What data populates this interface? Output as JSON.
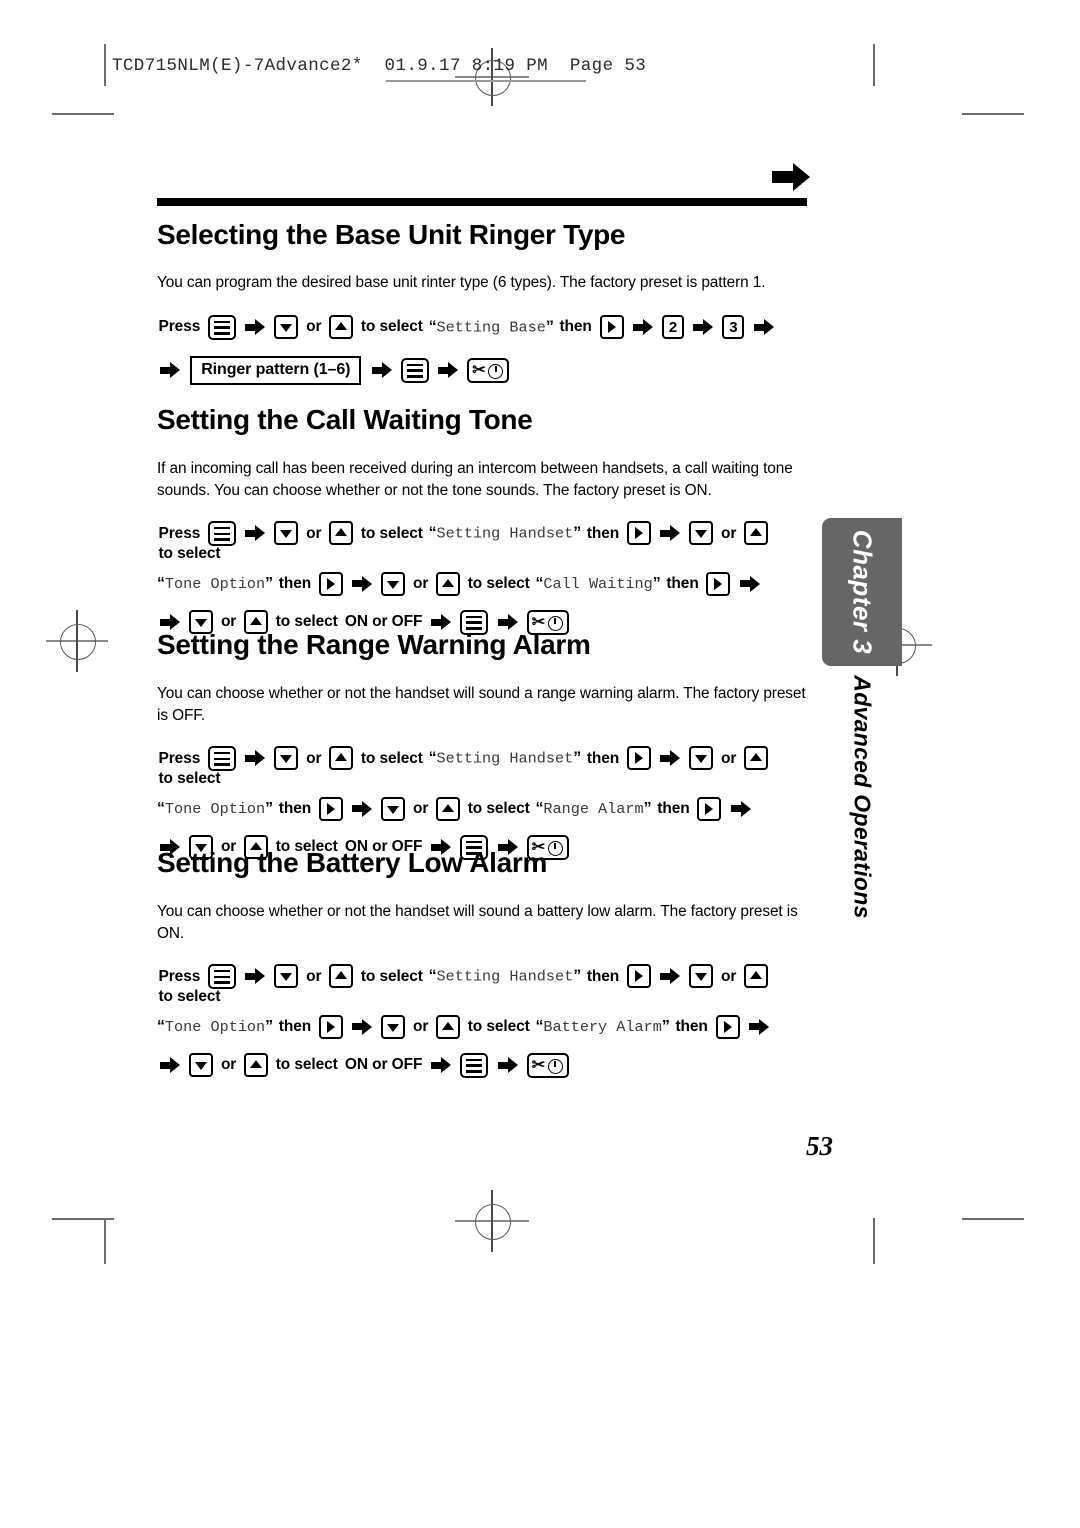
{
  "print_slug": {
    "text": "TCD715NLM(E)-7Advance2*  01.9.17 8:19 PM  Page 53"
  },
  "page_number": "53",
  "chapter_tab": {
    "title": "Chapter 3",
    "subtitle": "Advanced Operations",
    "background_color": "#666666",
    "title_color": "#ffffff"
  },
  "icons": {
    "menu": "menu-key-icon",
    "down": "down-arrow-key-icon",
    "up": "up-arrow-key-icon",
    "right": "right-arrow-key-icon",
    "off": "phone-off-key-icon",
    "step_arrow": "step-arrow-icon",
    "section_arrow": "section-pointer-arrow-icon"
  },
  "sections": [
    {
      "id": "base-unit-ringer-type",
      "heading": "Selecting the Base Unit Ringer Type",
      "body": "You can program the desired base unit rinter type (6 types). The factory preset is pattern 1.",
      "steps_line1": {
        "press_label": "Press",
        "or_label": "or",
        "to_select_label": "to select",
        "then_label": "then",
        "target": "Setting Base",
        "num_keys": [
          "2",
          "3"
        ]
      },
      "steps_line2": {
        "boxed_label": "Ringer pattern (1–6)"
      }
    },
    {
      "id": "call-waiting-tone",
      "heading": "Setting the Call Waiting Tone",
      "body": "If an incoming call has been received during an intercom between handsets, a call waiting tone sounds. You can choose whether or not the tone sounds. The factory preset is ON.",
      "steps": {
        "press_label": "Press",
        "or_label": "or",
        "to_select_label": "to select",
        "then_label": "then",
        "target1": "Setting Handset",
        "target2": "Tone Option",
        "target3": "Call Waiting",
        "on_off_label": "ON or OFF"
      }
    },
    {
      "id": "range-warning-alarm",
      "heading": "Setting the Range Warning Alarm",
      "body": "You can choose whether or not the handset will sound a range warning alarm. The factory preset is OFF.",
      "steps": {
        "press_label": "Press",
        "or_label": "or",
        "to_select_label": "to select",
        "then_label": "then",
        "target1": "Setting Handset",
        "target2": "Tone Option",
        "target3": "Range Alarm",
        "on_off_label": "ON or OFF"
      }
    },
    {
      "id": "battery-low-alarm",
      "heading": "Setting the Battery Low Alarm",
      "body": "You can choose whether or not the handset will sound a battery low alarm. The factory preset is ON.",
      "steps": {
        "press_label": "Press",
        "or_label": "or",
        "to_select_label": "to select",
        "then_label": "then",
        "target1": "Setting Handset",
        "target2": "Tone Option",
        "target3": "Battery Alarm",
        "on_off_label": "ON or OFF"
      }
    }
  ]
}
